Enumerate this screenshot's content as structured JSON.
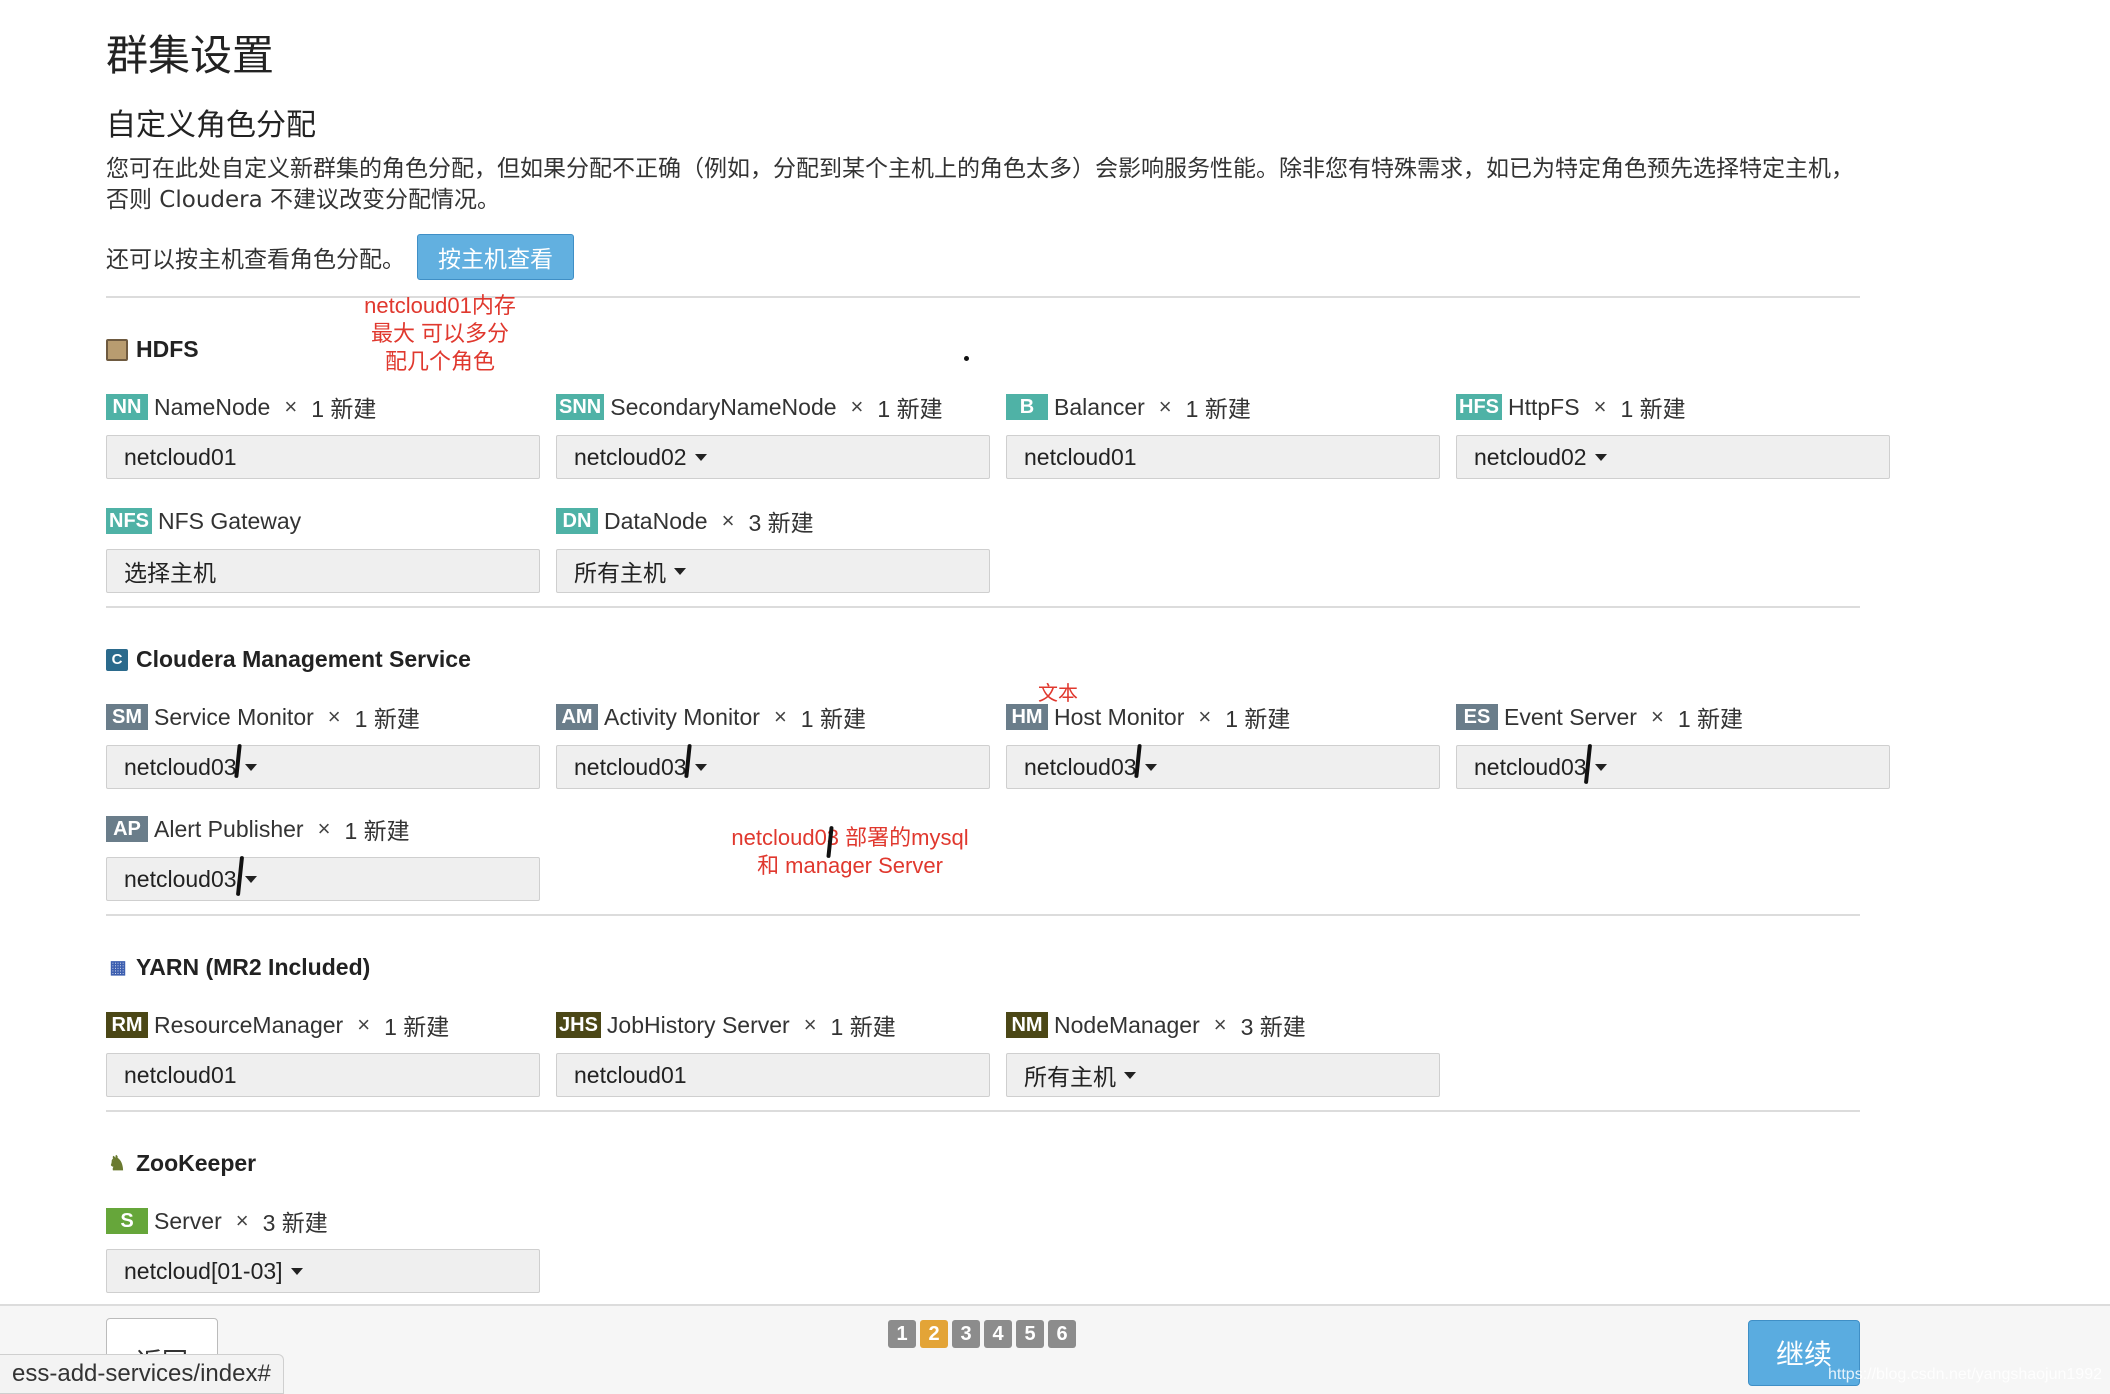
{
  "page": {
    "title": "群集设置",
    "subtitle": "自定义角色分配",
    "intro": "您可在此处自定义新群集的角色分配，但如果分配不正确（例如，分配到某个主机上的角色太多）会影响服务性能。除非您有特殊需求，如已为特定角色预先选择特定主机，否则 Cloudera 不建议改变分配情况。",
    "by_host_text": "还可以按主机查看角色分配。",
    "by_host_button": "按主机查看"
  },
  "services": {
    "hdfs": {
      "name": "HDFS",
      "roles": {
        "namenode": {
          "badge": "NN",
          "name": "NameNode",
          "times": "×",
          "count": "1 新建",
          "host": "netcloud01"
        },
        "snn": {
          "badge": "SNN",
          "name": "SecondaryNameNode",
          "times": "×",
          "count": "1 新建",
          "host": "netcloud02"
        },
        "balancer": {
          "badge": "B",
          "name": "Balancer",
          "times": "×",
          "count": "1 新建",
          "host": "netcloud01"
        },
        "httpfs": {
          "badge": "HFS",
          "name": "HttpFS",
          "times": "×",
          "count": "1 新建",
          "host": "netcloud02"
        },
        "nfs": {
          "badge": "NFS",
          "name": "NFS Gateway",
          "host": "选择主机"
        },
        "datanode": {
          "badge": "DN",
          "name": "DataNode",
          "times": "×",
          "count": "3 新建",
          "host": "所有主机"
        }
      }
    },
    "cms": {
      "name": "Cloudera Management Service",
      "icon": "C",
      "roles": {
        "sm": {
          "badge": "SM",
          "name": "Service Monitor",
          "times": "×",
          "count": "1 新建",
          "host": "netcloud03"
        },
        "am": {
          "badge": "AM",
          "name": "Activity Monitor",
          "times": "×",
          "count": "1 新建",
          "host": "netcloud03"
        },
        "hm": {
          "badge": "HM",
          "name": "Host Monitor",
          "times": "×",
          "count": "1 新建",
          "host": "netcloud03"
        },
        "es": {
          "badge": "ES",
          "name": "Event Server",
          "times": "×",
          "count": "1 新建",
          "host": "netcloud03"
        },
        "ap": {
          "badge": "AP",
          "name": "Alert Publisher",
          "times": "×",
          "count": "1 新建",
          "host": "netcloud03"
        }
      }
    },
    "yarn": {
      "name": "YARN (MR2 Included)",
      "roles": {
        "rm": {
          "badge": "RM",
          "name": "ResourceManager",
          "times": "×",
          "count": "1 新建",
          "host": "netcloud01"
        },
        "jhs": {
          "badge": "JHS",
          "name": "JobHistory Server",
          "times": "×",
          "count": "1 新建",
          "host": "netcloud01"
        },
        "nm": {
          "badge": "NM",
          "name": "NodeManager",
          "times": "×",
          "count": "3 新建",
          "host": "所有主机"
        }
      }
    },
    "zookeeper": {
      "name": "ZooKeeper",
      "roles": {
        "server": {
          "badge": "S",
          "name": "Server",
          "times": "×",
          "count": "3 新建",
          "host": "netcloud[01-03]"
        }
      }
    }
  },
  "annotations": {
    "memory_note": "netcloud01内存\n最大 可以多分\n配几个角色",
    "text_note": "文本",
    "mysql_note": "netcloud03 部署的mysql\n和 manager Server"
  },
  "footer": {
    "back": "返回",
    "steps": [
      "1",
      "2",
      "3",
      "4",
      "5",
      "6"
    ],
    "active_step": "2",
    "continue": "继续",
    "url": "ess-add-services/index#",
    "watermark": "https://blog.csdn.net/yangshaojun1992"
  },
  "colors": {
    "primary_button": "#62b0e0",
    "badge_hdfs": "#4fb2a6",
    "badge_cms": "#6a7d8a",
    "badge_yarn": "#4b4716",
    "badge_zk": "#66a63a",
    "annotation": "#e0382e",
    "active_step": "#e3a437"
  }
}
